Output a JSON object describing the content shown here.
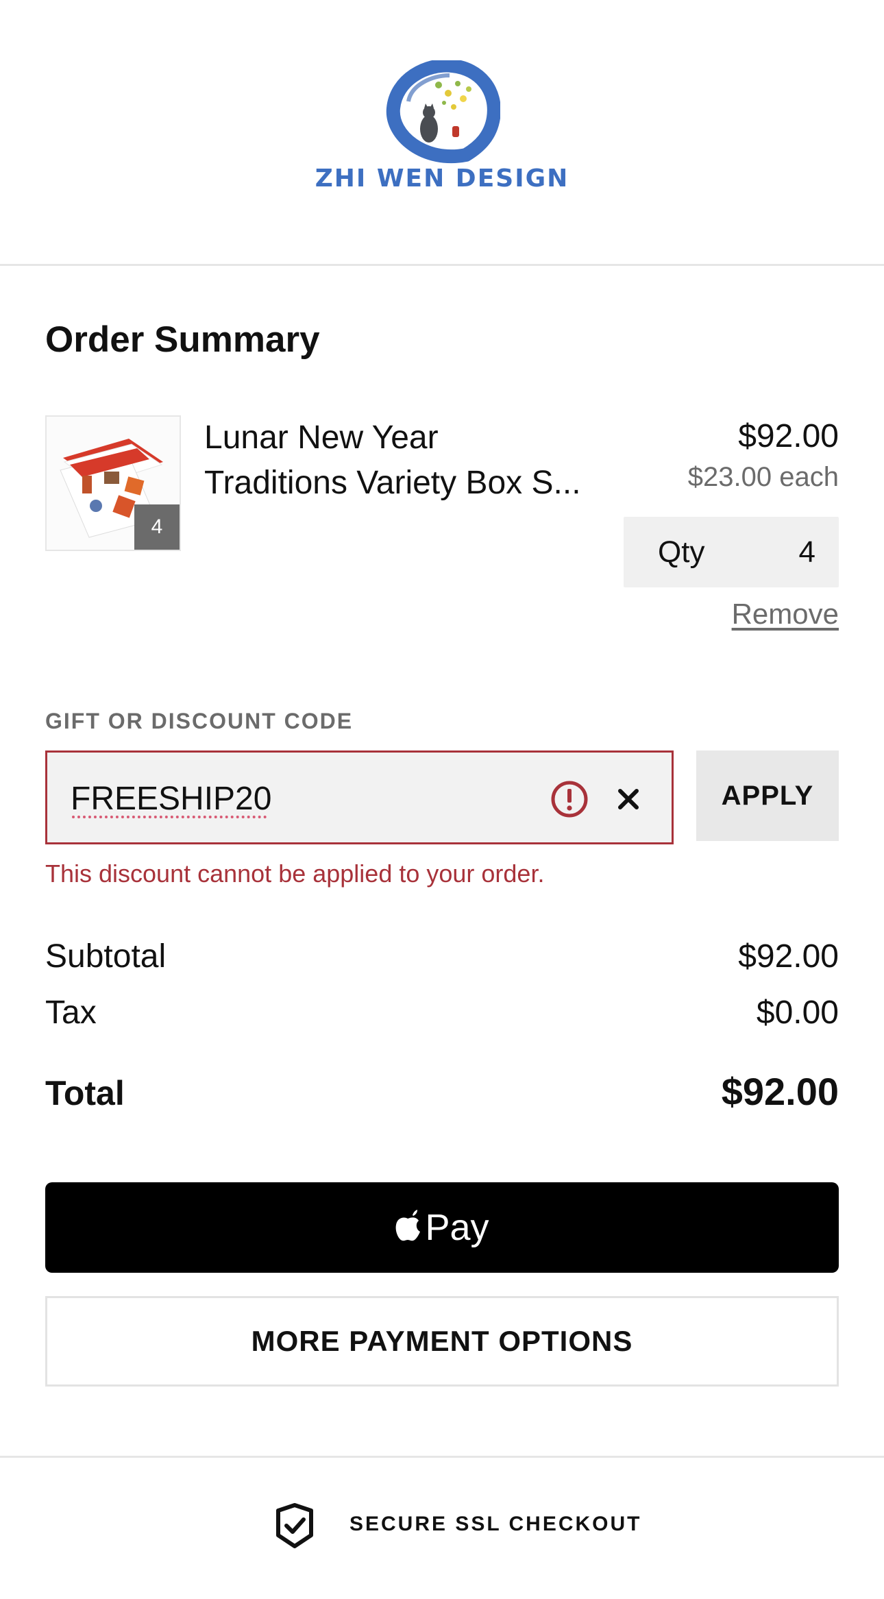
{
  "brand": {
    "name": "ZHI WEN DESIGN",
    "logo_icon": "zen-circle-cat-logo",
    "color": "#3d6fc1"
  },
  "order_summary": {
    "title": "Order Summary",
    "item": {
      "name_line1": "Lunar New Year",
      "name_line2": "Traditions Variety Box S...",
      "price": "$92.00",
      "each": "$23.00 each",
      "thumb_badge": "4",
      "qty_label": "Qty",
      "qty_value": "4",
      "remove_label": "Remove"
    }
  },
  "discount": {
    "label": "GIFT OR DISCOUNT CODE",
    "value": "FREESHIP20",
    "apply_label": "APPLY",
    "error": "This discount cannot be applied to your order.",
    "error_color": "#a8323a"
  },
  "totals": {
    "subtotal_label": "Subtotal",
    "subtotal_value": "$92.00",
    "tax_label": "Tax",
    "tax_value": "$0.00",
    "total_label": "Total",
    "total_value": "$92.00"
  },
  "payment": {
    "applepay_label": "Pay",
    "more_label": "MORE PAYMENT OPTIONS"
  },
  "footer": {
    "secure_label": "SECURE SSL CHECKOUT"
  }
}
